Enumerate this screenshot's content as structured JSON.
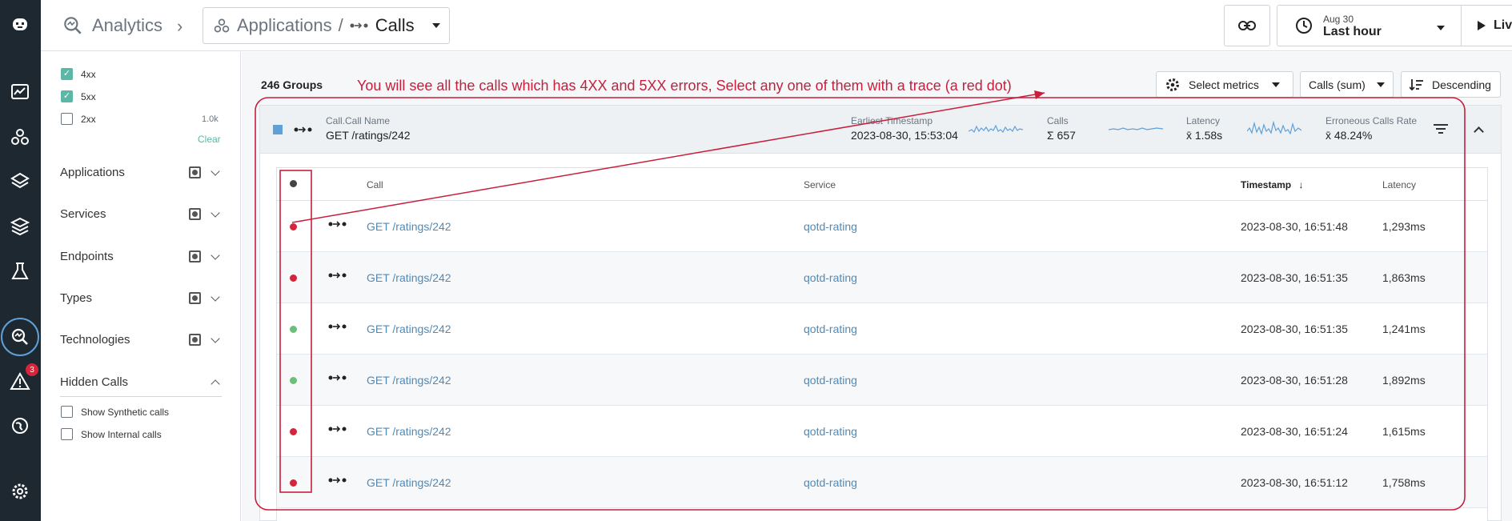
{
  "breadcrumb": {
    "section": "Analytics",
    "app": "Applications",
    "separator": "/",
    "view": "Calls"
  },
  "time_picker": {
    "date": "Aug 30",
    "range": "Last hour",
    "live_label": "Live"
  },
  "rail": {
    "alert_count": "3"
  },
  "filters": {
    "status_checkboxes": [
      {
        "label": "4xx",
        "checked": true,
        "count": ""
      },
      {
        "label": "5xx",
        "checked": true,
        "count": ""
      },
      {
        "label": "2xx",
        "checked": false,
        "count": "1.0k"
      }
    ],
    "clear_label": "Clear",
    "facets": [
      "Applications",
      "Services",
      "Endpoints",
      "Types",
      "Technologies"
    ],
    "hidden_calls": {
      "title": "Hidden Calls",
      "options": [
        "Show Synthetic calls",
        "Show Internal calls"
      ]
    }
  },
  "toolbar": {
    "groups_count": "246 Groups",
    "select_metrics": "Select metrics",
    "calls_sum": "Calls (sum)",
    "sort": "Descending"
  },
  "annotation": {
    "text": "You will see all the calls which has 4XX and 5XX errors, Select any one of them with a trace (a red dot)",
    "color": "#c81e3c"
  },
  "group": {
    "name_label": "Call.Call Name",
    "name": "GET /ratings/242",
    "earliest_label": "Earliest Timestamp",
    "earliest": "2023-08-30, 15:53:04",
    "calls_label": "Calls",
    "calls_value": "Σ 657",
    "latency_label": "Latency",
    "latency_value": "x̄ 1.58s",
    "error_label": "Erroneous Calls Rate",
    "error_value": "x̄ 48.24%"
  },
  "table": {
    "columns": {
      "call": "Call",
      "service": "Service",
      "timestamp": "Timestamp",
      "latency": "Latency"
    },
    "rows": [
      {
        "status": "error",
        "call": "GET /ratings/242",
        "service": "qotd-rating",
        "timestamp": "2023-08-30, 16:51:48",
        "latency": "1,293ms"
      },
      {
        "status": "error",
        "call": "GET /ratings/242",
        "service": "qotd-rating",
        "timestamp": "2023-08-30, 16:51:35",
        "latency": "1,863ms"
      },
      {
        "status": "ok",
        "call": "GET /ratings/242",
        "service": "qotd-rating",
        "timestamp": "2023-08-30, 16:51:35",
        "latency": "1,241ms"
      },
      {
        "status": "ok",
        "call": "GET /ratings/242",
        "service": "qotd-rating",
        "timestamp": "2023-08-30, 16:51:28",
        "latency": "1,892ms"
      },
      {
        "status": "error",
        "call": "GET /ratings/242",
        "service": "qotd-rating",
        "timestamp": "2023-08-30, 16:51:24",
        "latency": "1,615ms"
      },
      {
        "status": "error",
        "call": "GET /ratings/242",
        "service": "qotd-rating",
        "timestamp": "2023-08-30, 16:51:12",
        "latency": "1,758ms"
      }
    ]
  },
  "colors": {
    "error": "#d6243b",
    "ok": "#6cbf7a",
    "accent": "#5fa0d8",
    "link": "#4f8ab7"
  }
}
